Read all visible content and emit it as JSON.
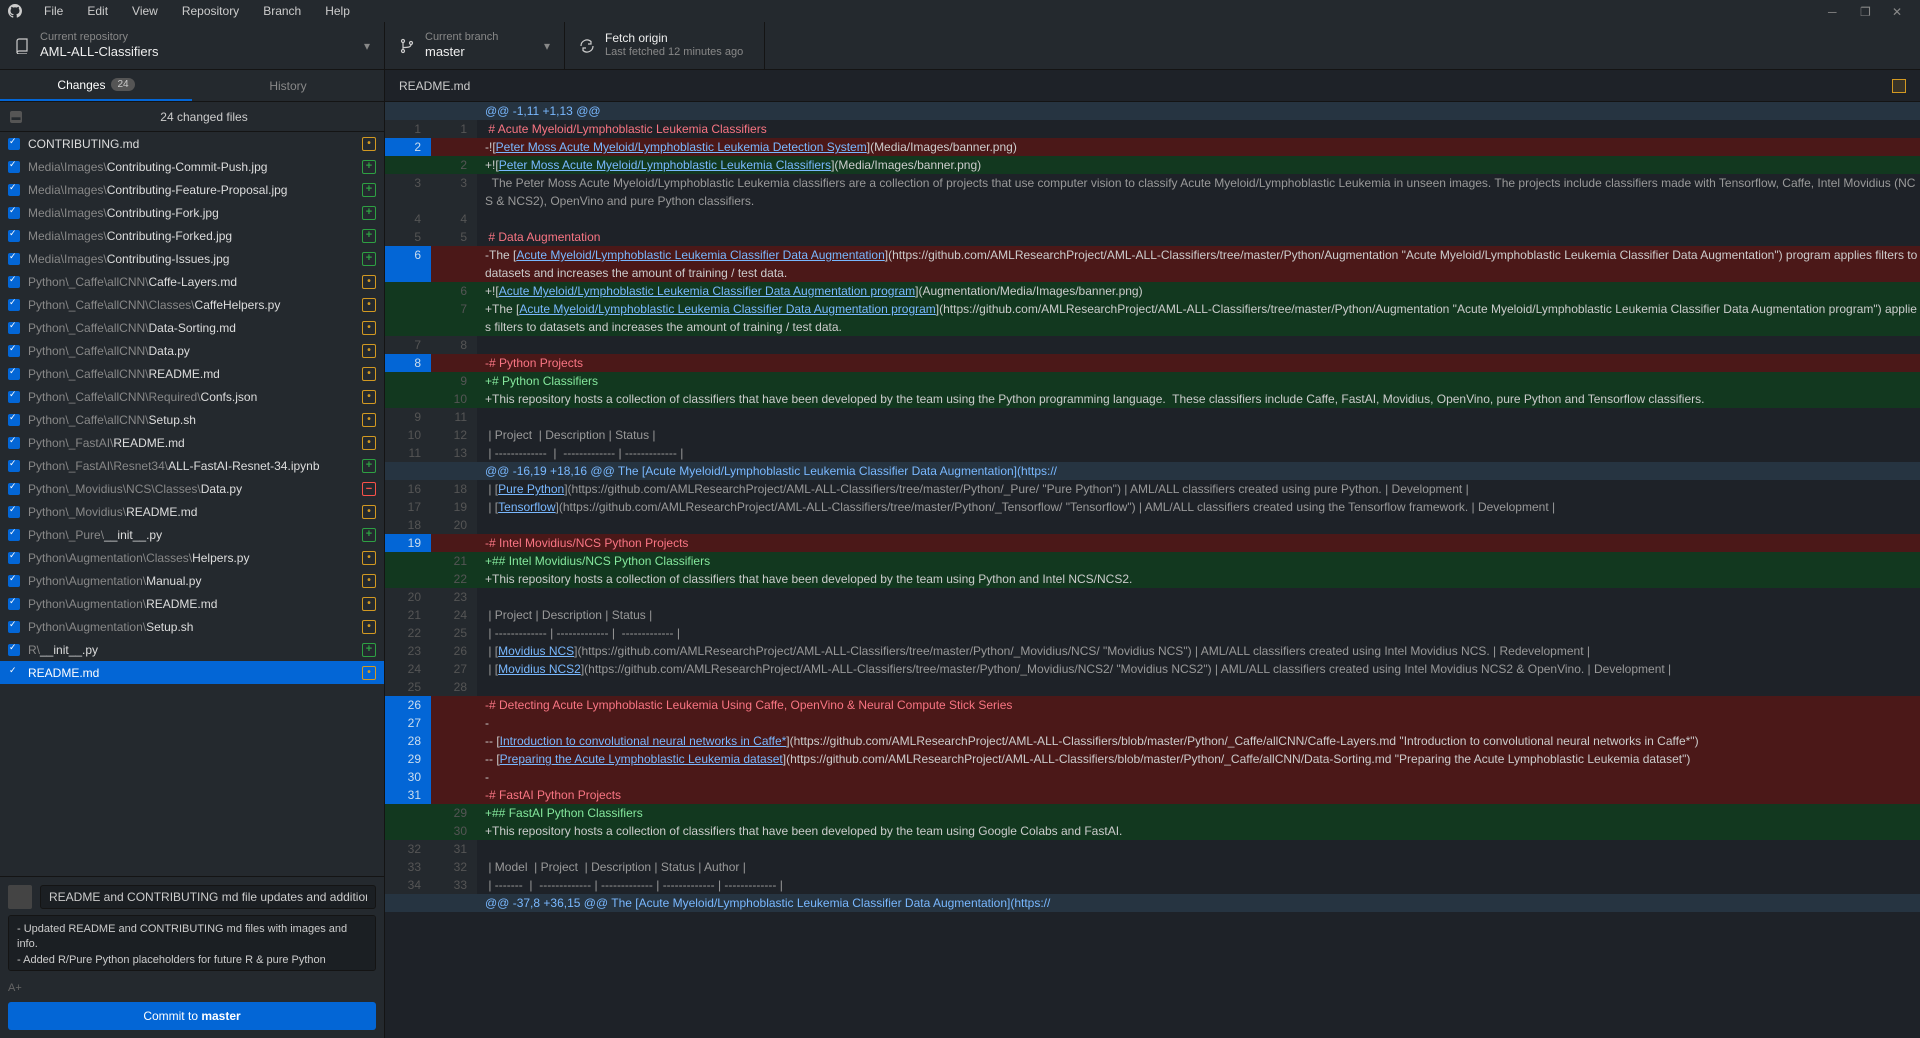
{
  "menus": [
    "File",
    "Edit",
    "View",
    "Repository",
    "Branch",
    "Help"
  ],
  "repo": {
    "label": "Current repository",
    "name": "AML-ALL-Classifiers"
  },
  "branch": {
    "label": "Current branch",
    "name": "master"
  },
  "fetch": {
    "label": "Fetch origin",
    "sub": "Last fetched 12 minutes ago"
  },
  "tabs": {
    "changes": "Changes",
    "changes_count": "24",
    "history": "History"
  },
  "summary": "24 changed files",
  "files": [
    {
      "dir": "",
      "name": "CONTRIBUTING.md",
      "st": "modified"
    },
    {
      "dir": "Media\\Images\\",
      "name": "Contributing-Commit-Push.jpg",
      "st": "added"
    },
    {
      "dir": "Media\\Images\\",
      "name": "Contributing-Feature-Proposal.jpg",
      "st": "added"
    },
    {
      "dir": "Media\\Images\\",
      "name": "Contributing-Fork.jpg",
      "st": "added"
    },
    {
      "dir": "Media\\Images\\",
      "name": "Contributing-Forked.jpg",
      "st": "added"
    },
    {
      "dir": "Media\\Images\\",
      "name": "Contributing-Issues.jpg",
      "st": "added"
    },
    {
      "dir": "Python\\_Caffe\\allCNN\\",
      "name": "Caffe-Layers.md",
      "st": "modified"
    },
    {
      "dir": "Python\\_Caffe\\allCNN\\Classes\\",
      "name": "CaffeHelpers.py",
      "st": "modified"
    },
    {
      "dir": "Python\\_Caffe\\allCNN\\",
      "name": "Data-Sorting.md",
      "st": "modified"
    },
    {
      "dir": "Python\\_Caffe\\allCNN\\",
      "name": "Data.py",
      "st": "modified"
    },
    {
      "dir": "Python\\_Caffe\\allCNN\\",
      "name": "README.md",
      "st": "modified"
    },
    {
      "dir": "Python\\_Caffe\\allCNN\\Required\\",
      "name": "Confs.json",
      "st": "modified"
    },
    {
      "dir": "Python\\_Caffe\\allCNN\\",
      "name": "Setup.sh",
      "st": "modified"
    },
    {
      "dir": "Python\\_FastAI\\",
      "name": "README.md",
      "st": "modified"
    },
    {
      "dir": "Python\\_FastAI\\Resnet34\\",
      "name": "ALL-FastAI-Resnet-34.ipynb",
      "st": "added"
    },
    {
      "dir": "Python\\_Movidius\\NCS\\Classes\\",
      "name": "Data.py",
      "st": "deleted"
    },
    {
      "dir": "Python\\_Movidius\\",
      "name": "README.md",
      "st": "modified"
    },
    {
      "dir": "Python\\_Pure\\",
      "name": "__init__.py",
      "st": "added"
    },
    {
      "dir": "Python\\Augmentation\\Classes\\",
      "name": "Helpers.py",
      "st": "modified"
    },
    {
      "dir": "Python\\Augmentation\\",
      "name": "Manual.py",
      "st": "modified"
    },
    {
      "dir": "Python\\Augmentation\\",
      "name": "README.md",
      "st": "modified"
    },
    {
      "dir": "Python\\Augmentation\\",
      "name": "Setup.sh",
      "st": "modified"
    },
    {
      "dir": "R\\",
      "name": "__init__.py",
      "st": "added"
    },
    {
      "dir": "",
      "name": "README.md",
      "st": "modified",
      "selected": true
    }
  ],
  "commit": {
    "summary": "README and CONTRIBUTING md file updates and addition of R/Pure Python plac",
    "desc": "- Updated README and CONTRIBUTING md files with images and info.\n- Added R/Pure Python placeholders for future R & pure Python projects",
    "coauthor": "A+",
    "btn_pre": "Commit to ",
    "btn_bold": "master"
  },
  "open_file": "README.md",
  "diff": [
    {
      "t": "hunk",
      "o": "",
      "n": "",
      "c": "@@ -1,11 +1,13 @@"
    },
    {
      "t": "ctx",
      "o": "1",
      "n": "1",
      "c": " # Acute Myeloid/Lymphoblastic Leukemia Classifiers",
      "hd": true
    },
    {
      "t": "del",
      "o": "2",
      "n": "",
      "c": "-![",
      "lk": "Peter Moss Acute Myeloid/Lymphoblastic Leukemia Detection System",
      "post": "](Media/Images/banner.png)"
    },
    {
      "t": "add",
      "o": "",
      "n": "2",
      "c": "+![",
      "lk": "Peter Moss Acute Myeloid/Lymphoblastic Leukemia Classifiers",
      "post": "](Media/Images/banner.png)"
    },
    {
      "t": "ctx",
      "o": "3",
      "n": "3",
      "c": "  The Peter Moss Acute Myeloid/Lymphoblastic Leukemia classifiers are a collection of projects that use computer vision to classify Acute Myeloid/Lymphoblastic Leukemia in unseen images. The projects include classifiers made with Tensorflow, Caffe, Intel Movidius (NCS & NCS2), OpenVino and pure Python classifiers."
    },
    {
      "t": "ctx",
      "o": "4",
      "n": "4",
      "c": " "
    },
    {
      "t": "ctx",
      "o": "5",
      "n": "5",
      "c": " # Data Augmentation",
      "hd": true
    },
    {
      "t": "del",
      "o": "6",
      "n": "",
      "c": "-The [",
      "lk": "Acute Myeloid/Lymphoblastic Leukemia Classifier Data Augmentation",
      "post": "](https://github.com/AMLResearchProject/AML-ALL-Classifiers/tree/master/Python/Augmentation \"Acute Myeloid/Lymphoblastic Leukemia Classifier Data Augmentation\") program applies filters to datasets and increases the amount of training / test data."
    },
    {
      "t": "add",
      "o": "",
      "n": "6",
      "c": "+![",
      "lk": "Acute Myeloid/Lymphoblastic Leukemia Classifier Data Augmentation program",
      "post": "](Augmentation/Media/Images/banner.png)"
    },
    {
      "t": "add",
      "o": "",
      "n": "7",
      "c": "+The [",
      "lk": "Acute Myeloid/Lymphoblastic Leukemia Classifier Data Augmentation program",
      "post": "](https://github.com/AMLResearchProject/AML-ALL-Classifiers/tree/master/Python/Augmentation \"Acute Myeloid/Lymphoblastic Leukemia Classifier Data Augmentation program\") applies filters to datasets and increases the amount of training / test data."
    },
    {
      "t": "ctx",
      "o": "7",
      "n": "8",
      "c": " "
    },
    {
      "t": "del",
      "o": "8",
      "n": "",
      "c": "-# Python Projects",
      "hd": true
    },
    {
      "t": "add",
      "o": "",
      "n": "9",
      "c": "+# Python Classifiers",
      "hd2": true
    },
    {
      "t": "add",
      "o": "",
      "n": "10",
      "c": "+This repository hosts a collection of classifiers that have been developed by the team using the Python programming language.  These classifiers include Caffe, FastAI, Movidius, OpenVino, pure Python and Tensorflow classifiers."
    },
    {
      "t": "ctx",
      "o": "9",
      "n": "11",
      "c": " "
    },
    {
      "t": "ctx",
      "o": "10",
      "n": "12",
      "c": " | Project  | Description | Status |"
    },
    {
      "t": "ctx",
      "o": "11",
      "n": "13",
      "c": " | -------------  |  ------------- | ------------- |"
    },
    {
      "t": "hunk",
      "o": "",
      "n": "",
      "c": "@@ -16,19 +18,16 @@ The [Acute Myeloid/Lymphoblastic Leukemia Classifier Data Augmentation](https://"
    },
    {
      "t": "ctx",
      "o": "16",
      "n": "18",
      "c": " | [",
      "lk": "Pure Python",
      "post": "](https://github.com/AMLResearchProject/AML-ALL-Classifiers/tree/master/Python/_Pure/ \"Pure Python\") | AML/ALL classifiers created using pure Python. | Development |"
    },
    {
      "t": "ctx",
      "o": "17",
      "n": "19",
      "c": " | [",
      "lk": "Tensorflow",
      "post": "](https://github.com/AMLResearchProject/AML-ALL-Classifiers/tree/master/Python/_Tensorflow/ \"Tensorflow\") | AML/ALL classifiers created using the Tensorflow framework. | Development |"
    },
    {
      "t": "ctx",
      "o": "18",
      "n": "20",
      "c": " "
    },
    {
      "t": "del",
      "o": "19",
      "n": "",
      "c": "-# Intel Movidius/NCS Python Projects",
      "hd": true
    },
    {
      "t": "add",
      "o": "",
      "n": "21",
      "c": "+## Intel Movidius/NCS Python Classifiers",
      "hd2": true
    },
    {
      "t": "add",
      "o": "",
      "n": "22",
      "c": "+This repository hosts a collection of classifiers that have been developed by the team using Python and Intel NCS/NCS2."
    },
    {
      "t": "ctx",
      "o": "20",
      "n": "23",
      "c": " "
    },
    {
      "t": "ctx",
      "o": "21",
      "n": "24",
      "c": " | Project | Description | Status |"
    },
    {
      "t": "ctx",
      "o": "22",
      "n": "25",
      "c": " | ------------- | ------------- |  ------------- |"
    },
    {
      "t": "ctx",
      "o": "23",
      "n": "26",
      "c": " | [",
      "lk": "Movidius NCS",
      "post": "](https://github.com/AMLResearchProject/AML-ALL-Classifiers/tree/master/Python/_Movidius/NCS/ \"Movidius NCS\") | AML/ALL classifiers created using Intel Movidius NCS. | Redevelopment |"
    },
    {
      "t": "ctx",
      "o": "24",
      "n": "27",
      "c": " | [",
      "lk": "Movidius NCS2",
      "post": "](https://github.com/AMLResearchProject/AML-ALL-Classifiers/tree/master/Python/_Movidius/NCS2/ \"Movidius NCS2\") | AML/ALL classifiers created using Intel Movidius NCS2 & OpenVino. | Development |"
    },
    {
      "t": "ctx",
      "o": "25",
      "n": "28",
      "c": " "
    },
    {
      "t": "del",
      "o": "26",
      "n": "",
      "c": "-# Detecting Acute Lymphoblastic Leukemia Using Caffe, OpenVino & Neural Compute Stick Series",
      "hd": true
    },
    {
      "t": "del",
      "o": "27",
      "n": "",
      "c": "-"
    },
    {
      "t": "del",
      "o": "28",
      "n": "",
      "c": "-- [",
      "lk": "Introduction to convolutional neural networks in Caffe*",
      "post": "](https://github.com/AMLResearchProject/AML-ALL-Classifiers/blob/master/Python/_Caffe/allCNN/Caffe-Layers.md \"Introduction to convolutional neural networks in Caffe*\")"
    },
    {
      "t": "del",
      "o": "29",
      "n": "",
      "c": "-- [",
      "lk": "Preparing the Acute Lymphoblastic Leukemia dataset",
      "post": "](https://github.com/AMLResearchProject/AML-ALL-Classifiers/blob/master/Python/_Caffe/allCNN/Data-Sorting.md \"Preparing the Acute Lymphoblastic Leukemia dataset\")"
    },
    {
      "t": "del",
      "o": "30",
      "n": "",
      "c": "-"
    },
    {
      "t": "del",
      "o": "31",
      "n": "",
      "c": "-# FastAI Python Projects",
      "hd": true
    },
    {
      "t": "add",
      "o": "",
      "n": "29",
      "c": "+## FastAI Python Classifiers",
      "hd2": true
    },
    {
      "t": "add",
      "o": "",
      "n": "30",
      "c": "+This repository hosts a collection of classifiers that have been developed by the team using Google Colabs and FastAI."
    },
    {
      "t": "ctx",
      "o": "32",
      "n": "31",
      "c": " "
    },
    {
      "t": "ctx",
      "o": "33",
      "n": "32",
      "c": " | Model  | Project  | Description | Status | Author |"
    },
    {
      "t": "ctx",
      "o": "34",
      "n": "33",
      "c": " | -------  |  ------------- | ------------- | ------------- | ------------- |"
    },
    {
      "t": "hunk",
      "o": "",
      "n": "",
      "c": "@@ -37,8 +36,15 @@ The [Acute Myeloid/Lymphoblastic Leukemia Classifier Data Augmentation](https://"
    }
  ]
}
